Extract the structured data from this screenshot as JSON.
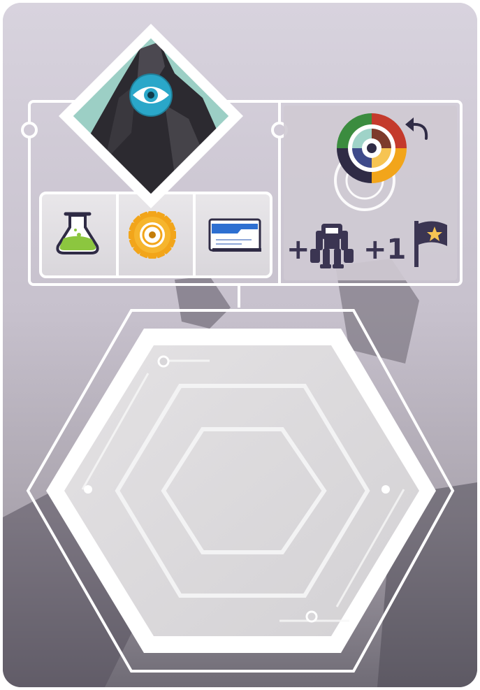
{
  "card": {
    "name": "mountain-eye-card",
    "emblem_icon": "mountain-eye-icon",
    "resource_icons": [
      "flask-icon",
      "gear-icon",
      "card-icon"
    ],
    "action_icon": "color-wheel-rotate-icon",
    "bonus": {
      "robot_prefix": "+",
      "flag_prefix": "+1",
      "robot_icon": "robot-icon",
      "flag_icon": "flag-star-icon"
    }
  },
  "colors": {
    "background": "#c9c3cf",
    "panel": "#e6e4e7",
    "frame": "#ffffff",
    "text": "#3b3552",
    "eye_blue": "#2aa7c9",
    "flask_green": "#8cc63f",
    "gear_orange": "#f2a51a",
    "card_blue": "#2d6fd1"
  }
}
